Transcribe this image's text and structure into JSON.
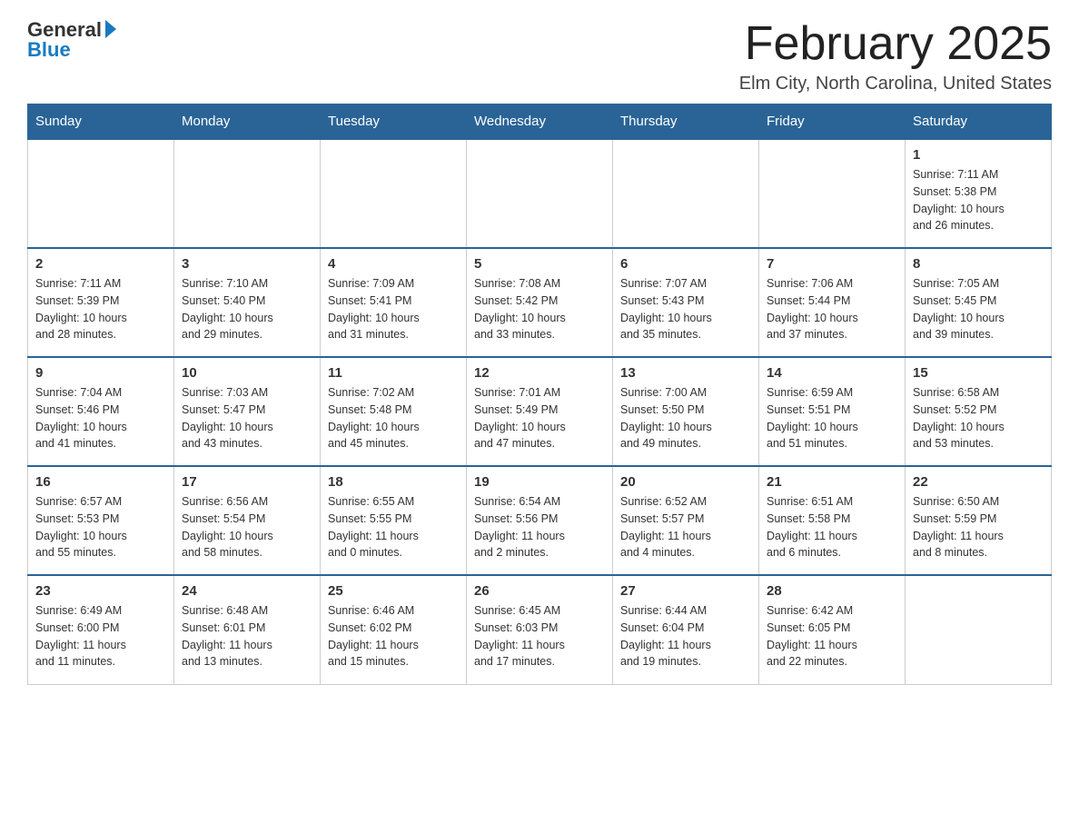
{
  "header": {
    "logo_general": "General",
    "logo_blue": "Blue",
    "month_title": "February 2025",
    "location": "Elm City, North Carolina, United States"
  },
  "days_of_week": [
    "Sunday",
    "Monday",
    "Tuesday",
    "Wednesday",
    "Thursday",
    "Friday",
    "Saturday"
  ],
  "weeks": [
    [
      {
        "day": "",
        "info": ""
      },
      {
        "day": "",
        "info": ""
      },
      {
        "day": "",
        "info": ""
      },
      {
        "day": "",
        "info": ""
      },
      {
        "day": "",
        "info": ""
      },
      {
        "day": "",
        "info": ""
      },
      {
        "day": "1",
        "info": "Sunrise: 7:11 AM\nSunset: 5:38 PM\nDaylight: 10 hours\nand 26 minutes."
      }
    ],
    [
      {
        "day": "2",
        "info": "Sunrise: 7:11 AM\nSunset: 5:39 PM\nDaylight: 10 hours\nand 28 minutes."
      },
      {
        "day": "3",
        "info": "Sunrise: 7:10 AM\nSunset: 5:40 PM\nDaylight: 10 hours\nand 29 minutes."
      },
      {
        "day": "4",
        "info": "Sunrise: 7:09 AM\nSunset: 5:41 PM\nDaylight: 10 hours\nand 31 minutes."
      },
      {
        "day": "5",
        "info": "Sunrise: 7:08 AM\nSunset: 5:42 PM\nDaylight: 10 hours\nand 33 minutes."
      },
      {
        "day": "6",
        "info": "Sunrise: 7:07 AM\nSunset: 5:43 PM\nDaylight: 10 hours\nand 35 minutes."
      },
      {
        "day": "7",
        "info": "Sunrise: 7:06 AM\nSunset: 5:44 PM\nDaylight: 10 hours\nand 37 minutes."
      },
      {
        "day": "8",
        "info": "Sunrise: 7:05 AM\nSunset: 5:45 PM\nDaylight: 10 hours\nand 39 minutes."
      }
    ],
    [
      {
        "day": "9",
        "info": "Sunrise: 7:04 AM\nSunset: 5:46 PM\nDaylight: 10 hours\nand 41 minutes."
      },
      {
        "day": "10",
        "info": "Sunrise: 7:03 AM\nSunset: 5:47 PM\nDaylight: 10 hours\nand 43 minutes."
      },
      {
        "day": "11",
        "info": "Sunrise: 7:02 AM\nSunset: 5:48 PM\nDaylight: 10 hours\nand 45 minutes."
      },
      {
        "day": "12",
        "info": "Sunrise: 7:01 AM\nSunset: 5:49 PM\nDaylight: 10 hours\nand 47 minutes."
      },
      {
        "day": "13",
        "info": "Sunrise: 7:00 AM\nSunset: 5:50 PM\nDaylight: 10 hours\nand 49 minutes."
      },
      {
        "day": "14",
        "info": "Sunrise: 6:59 AM\nSunset: 5:51 PM\nDaylight: 10 hours\nand 51 minutes."
      },
      {
        "day": "15",
        "info": "Sunrise: 6:58 AM\nSunset: 5:52 PM\nDaylight: 10 hours\nand 53 minutes."
      }
    ],
    [
      {
        "day": "16",
        "info": "Sunrise: 6:57 AM\nSunset: 5:53 PM\nDaylight: 10 hours\nand 55 minutes."
      },
      {
        "day": "17",
        "info": "Sunrise: 6:56 AM\nSunset: 5:54 PM\nDaylight: 10 hours\nand 58 minutes."
      },
      {
        "day": "18",
        "info": "Sunrise: 6:55 AM\nSunset: 5:55 PM\nDaylight: 11 hours\nand 0 minutes."
      },
      {
        "day": "19",
        "info": "Sunrise: 6:54 AM\nSunset: 5:56 PM\nDaylight: 11 hours\nand 2 minutes."
      },
      {
        "day": "20",
        "info": "Sunrise: 6:52 AM\nSunset: 5:57 PM\nDaylight: 11 hours\nand 4 minutes."
      },
      {
        "day": "21",
        "info": "Sunrise: 6:51 AM\nSunset: 5:58 PM\nDaylight: 11 hours\nand 6 minutes."
      },
      {
        "day": "22",
        "info": "Sunrise: 6:50 AM\nSunset: 5:59 PM\nDaylight: 11 hours\nand 8 minutes."
      }
    ],
    [
      {
        "day": "23",
        "info": "Sunrise: 6:49 AM\nSunset: 6:00 PM\nDaylight: 11 hours\nand 11 minutes."
      },
      {
        "day": "24",
        "info": "Sunrise: 6:48 AM\nSunset: 6:01 PM\nDaylight: 11 hours\nand 13 minutes."
      },
      {
        "day": "25",
        "info": "Sunrise: 6:46 AM\nSunset: 6:02 PM\nDaylight: 11 hours\nand 15 minutes."
      },
      {
        "day": "26",
        "info": "Sunrise: 6:45 AM\nSunset: 6:03 PM\nDaylight: 11 hours\nand 17 minutes."
      },
      {
        "day": "27",
        "info": "Sunrise: 6:44 AM\nSunset: 6:04 PM\nDaylight: 11 hours\nand 19 minutes."
      },
      {
        "day": "28",
        "info": "Sunrise: 6:42 AM\nSunset: 6:05 PM\nDaylight: 11 hours\nand 22 minutes."
      },
      {
        "day": "",
        "info": ""
      }
    ]
  ]
}
